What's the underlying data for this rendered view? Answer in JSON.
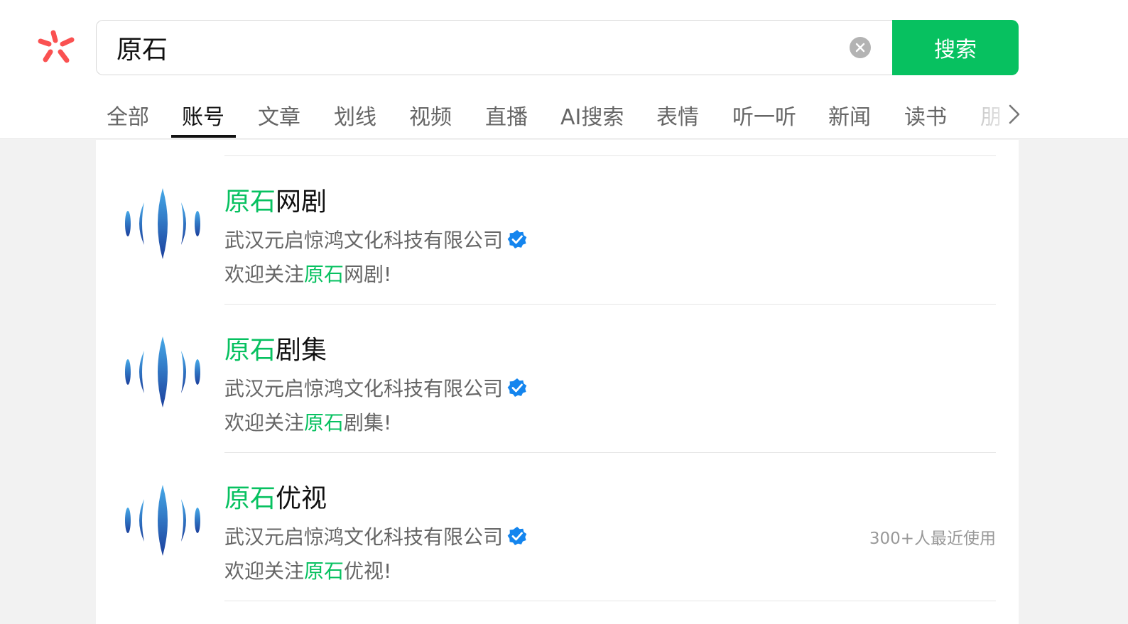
{
  "search": {
    "query": "原石",
    "button_label": "搜索"
  },
  "tabs": [
    {
      "label": "全部"
    },
    {
      "label": "账号"
    },
    {
      "label": "文章"
    },
    {
      "label": "划线"
    },
    {
      "label": "视频"
    },
    {
      "label": "直播"
    },
    {
      "label": "AI搜索"
    },
    {
      "label": "表情"
    },
    {
      "label": "听一听"
    },
    {
      "label": "新闻"
    },
    {
      "label": "读书"
    },
    {
      "label": "朋"
    }
  ],
  "active_tab": "账号",
  "results": [
    {
      "title_highlight": "原石",
      "title_rest": "网剧",
      "company": "武汉元启惊鸿文化科技有限公司",
      "desc_prefix": "欢迎关注",
      "desc_highlight": "原石",
      "desc_suffix": "网剧!",
      "usage": ""
    },
    {
      "title_highlight": "原石",
      "title_rest": "剧集",
      "company": "武汉元启惊鸿文化科技有限公司",
      "desc_prefix": "欢迎关注",
      "desc_highlight": "原石",
      "desc_suffix": "剧集!",
      "usage": ""
    },
    {
      "title_highlight": "原石",
      "title_rest": "优视",
      "company": "武汉元启惊鸿文化科技有限公司",
      "desc_prefix": "欢迎关注",
      "desc_highlight": "原石",
      "desc_suffix": "优视!",
      "usage": "300+人最近使用"
    }
  ],
  "icons": {
    "logo": "wechat-search-logo",
    "clear": "clear-icon",
    "more": "chevron-right-icon",
    "verified": "verified-badge-icon",
    "avatar": "sound-wave-icon"
  },
  "colors": {
    "accent": "#07c160",
    "logo": "#fa5151",
    "verified": "#1485ee",
    "avatar_top": "#45a9e8",
    "avatar_bottom": "#1b3f9c"
  }
}
